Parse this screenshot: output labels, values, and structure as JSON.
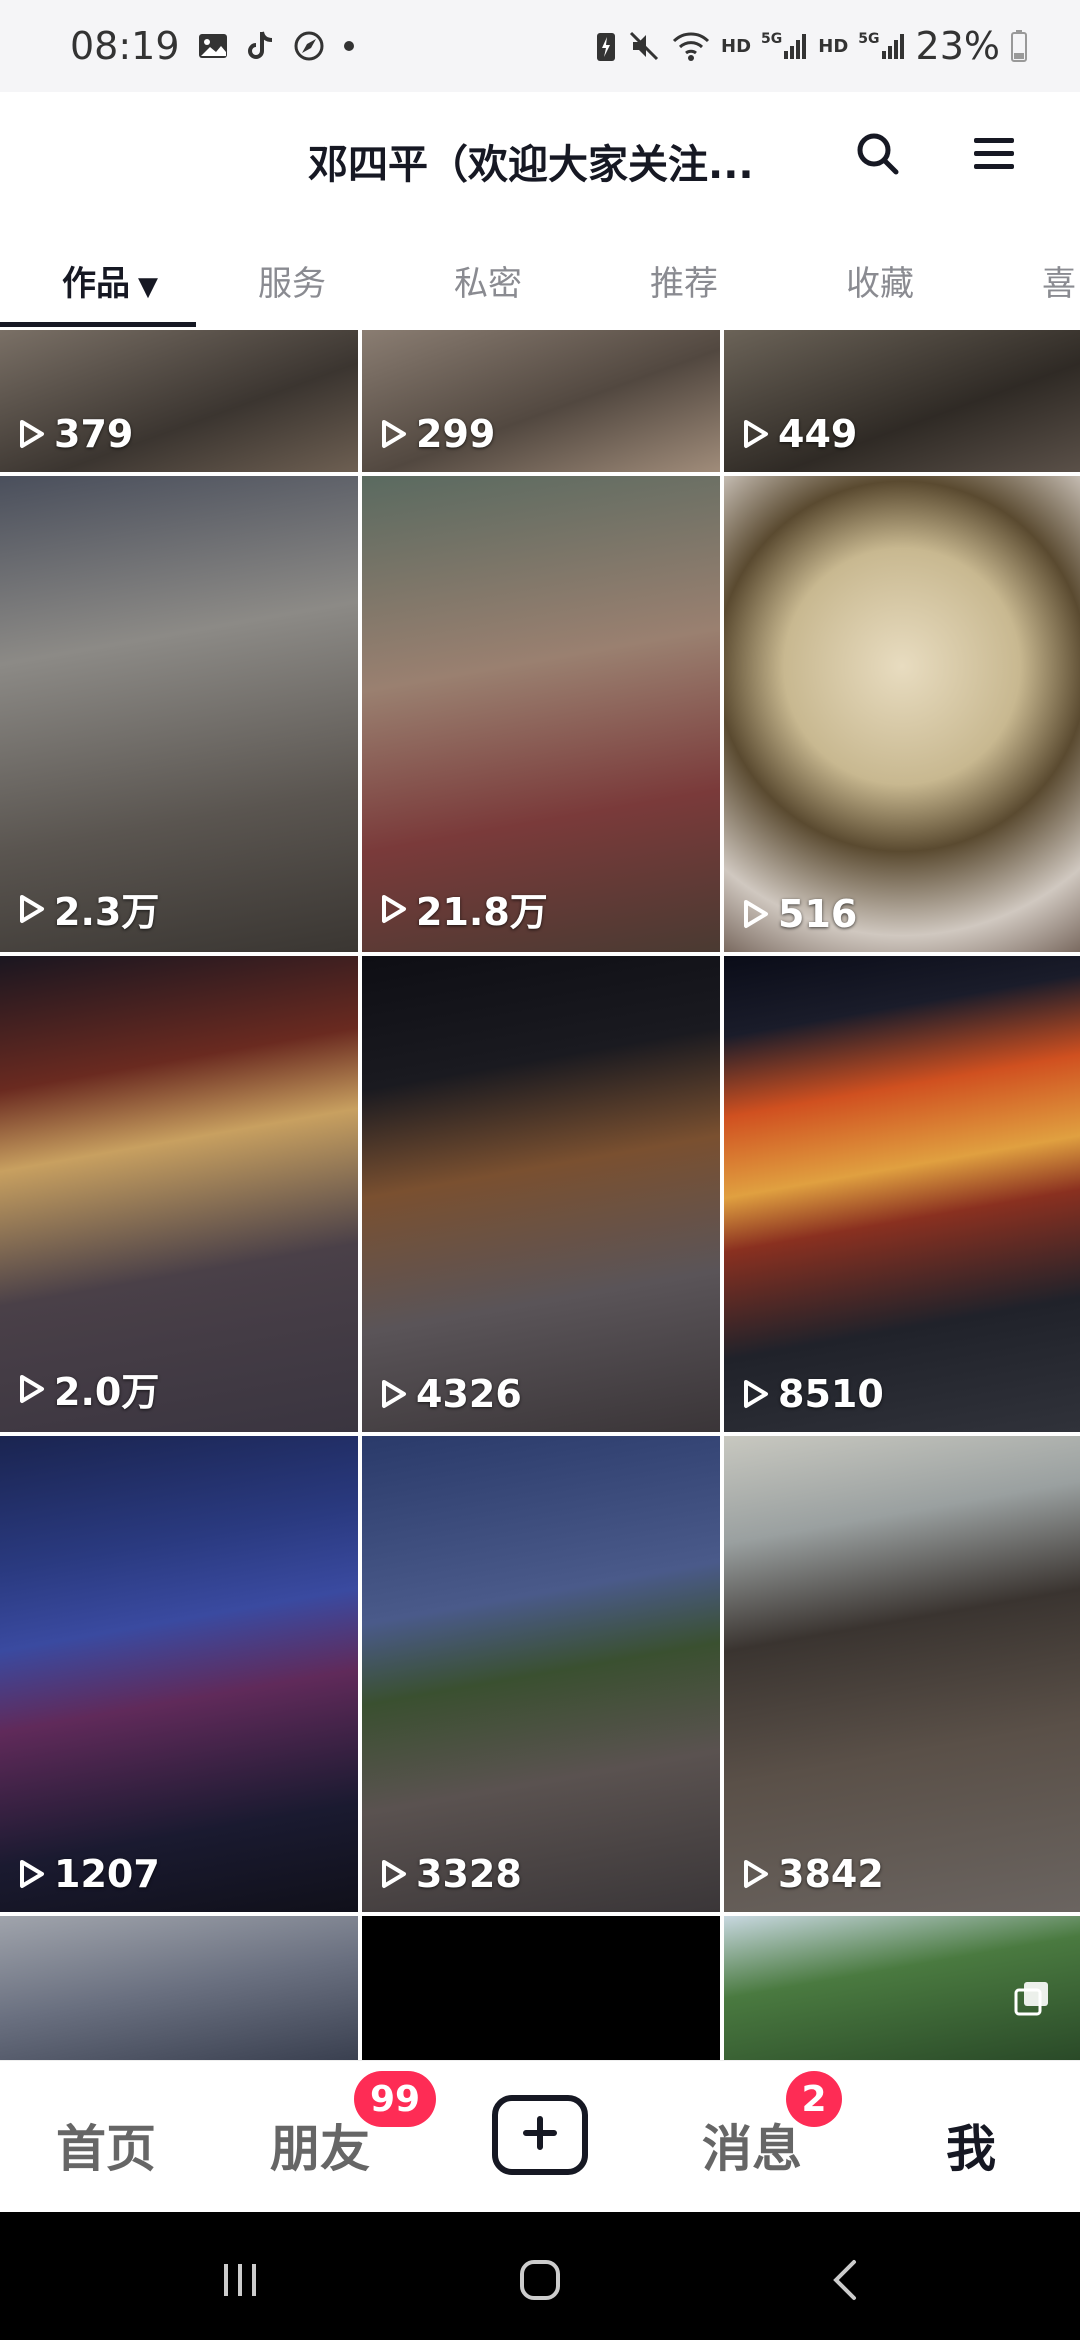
{
  "status_bar": {
    "time": "08:19",
    "left_icons": [
      "gallery-icon",
      "tiktok-icon",
      "compass-icon",
      "dot-icon"
    ],
    "right_icons": [
      "battery-saver-icon",
      "mute-icon",
      "wifi-icon",
      "hd-signal-icon",
      "5g-signal-icon"
    ],
    "hd1": "HD",
    "g1": "5G",
    "hd2": "HD",
    "g2": "5G",
    "battery": "23%"
  },
  "header": {
    "title": "邓四平（欢迎大家关注...",
    "search_icon": "search-icon",
    "menu_icon": "menu-icon"
  },
  "tabs": [
    {
      "label": "作品",
      "active": true
    },
    {
      "label": "服务"
    },
    {
      "label": "私密"
    },
    {
      "label": "推荐"
    },
    {
      "label": "收藏"
    },
    {
      "label": "喜"
    }
  ],
  "videos": [
    {
      "views": "379"
    },
    {
      "views": "299"
    },
    {
      "views": "449"
    },
    {
      "views": "2.3万"
    },
    {
      "views": "21.8万"
    },
    {
      "views": "516"
    },
    {
      "views": "2.0万"
    },
    {
      "views": "4326"
    },
    {
      "views": "8510"
    },
    {
      "views": "1207"
    },
    {
      "views": "3328"
    },
    {
      "views": "3842"
    },
    {
      "views": ""
    },
    {
      "views": ""
    },
    {
      "views": ""
    }
  ],
  "bottom_nav": {
    "home": "首页",
    "friends": "朋友",
    "friends_badge": "99",
    "create_icon": "plus-icon",
    "messages": "消息",
    "messages_badge": "2",
    "me": "我"
  },
  "system_nav": [
    "recents-icon",
    "home-icon",
    "back-icon"
  ],
  "colors": {
    "accent": "#fe2c55",
    "text": "#161823",
    "inactive": "#8a8b91"
  }
}
